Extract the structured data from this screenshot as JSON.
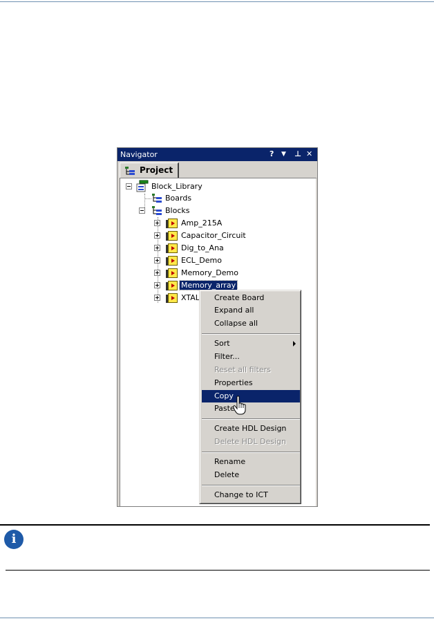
{
  "navigator": {
    "title": "Navigator",
    "controls": {
      "help": "?",
      "dropdown": "▼",
      "pin": "⊥",
      "close": "✕"
    },
    "tab_label": "Project"
  },
  "tree": {
    "root": "Block_Library",
    "boards": "Boards",
    "blocks": "Blocks",
    "items": [
      "Amp_215A",
      "Capacitor_Circuit",
      "Dig_to_Ana",
      "ECL_Demo",
      "Memory_Demo",
      "Memory_array",
      "XTAL"
    ],
    "selected_item": "Memory_array"
  },
  "context_menu": {
    "create_board": "Create Board",
    "expand_all": "Expand all",
    "collapse_all": "Collapse all",
    "sort": "Sort",
    "filter": "Filter...",
    "reset_all_filters": "Reset all filters",
    "properties": "Properties",
    "copy": "Copy",
    "paste": "Paste",
    "create_hdl_design": "Create HDL Design",
    "delete_hdl_design": "Delete HDL Design",
    "rename": "Rename",
    "delete": "Delete",
    "change_to_ict": "Change to ICT"
  },
  "note": {
    "icon": "i"
  },
  "colors": {
    "titlebar": "#0a246a",
    "selection": "#0a246a",
    "panel": "#d6d3ce",
    "info_icon": "#1e5aa8"
  }
}
